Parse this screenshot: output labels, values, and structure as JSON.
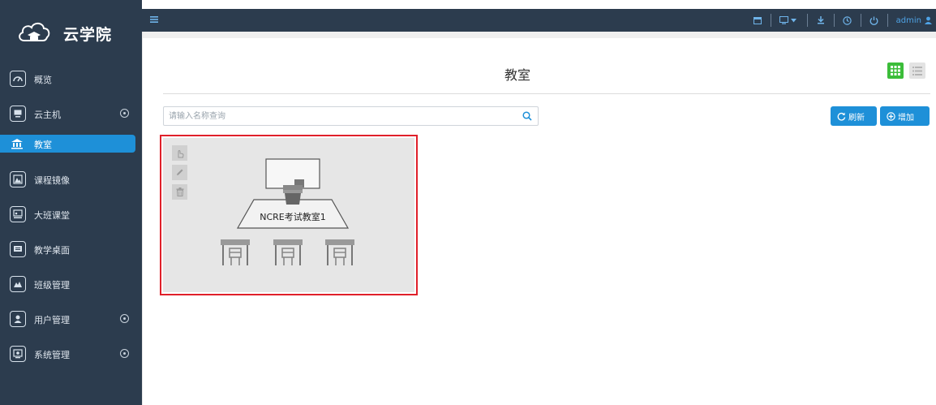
{
  "app": {
    "name": "云学院"
  },
  "sidebar": {
    "items": [
      {
        "label": "概览",
        "icon": "dashboard-icon",
        "expandable": false,
        "active": false
      },
      {
        "label": "云主机",
        "icon": "monitor-icon",
        "expandable": true,
        "active": false
      },
      {
        "label": "教室",
        "icon": "classroom-icon",
        "expandable": false,
        "active": true
      },
      {
        "label": "课程镜像",
        "icon": "image-icon",
        "expandable": false,
        "active": false
      },
      {
        "label": "大班课堂",
        "icon": "lecture-icon",
        "expandable": false,
        "active": false
      },
      {
        "label": "教学桌面",
        "icon": "desktop-icon",
        "expandable": false,
        "active": false
      },
      {
        "label": "班级管理",
        "icon": "class-icon",
        "expandable": false,
        "active": false
      },
      {
        "label": "用户管理",
        "icon": "user-icon",
        "expandable": true,
        "active": false
      },
      {
        "label": "系统管理",
        "icon": "system-icon",
        "expandable": true,
        "active": false
      }
    ]
  },
  "topbar": {
    "icons": [
      "menu-icon",
      "window-icon",
      "display-icon",
      "dropdown-caret-icon",
      "download-icon",
      "clock-icon",
      "power-icon",
      "user-icon"
    ],
    "username": "admin"
  },
  "main": {
    "title": "教室",
    "search": {
      "placeholder": "请输入名称查询",
      "value": ""
    },
    "buttons": {
      "refresh": "刷新",
      "add": "增加"
    },
    "classrooms": [
      {
        "name": "NCRE考试教室1"
      }
    ]
  },
  "colors": {
    "sidebar_bg": "#2c3c4e",
    "accent": "#1e90d8",
    "grid_view_active": "#3cbd3a",
    "card_bg": "#e6e6e6",
    "highlight": "#e0202a"
  }
}
